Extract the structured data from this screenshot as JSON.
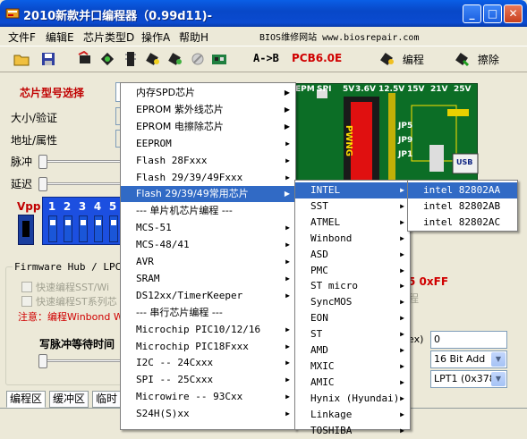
{
  "window": {
    "title": "2010新款并口编程器（0.99d11)-"
  },
  "title_buttons": {
    "minimize": "_",
    "maximize": "□",
    "close": "✕"
  },
  "menubar": {
    "items": [
      "文件F",
      "编辑E",
      "芯片类型D",
      "操作A",
      "帮助H"
    ],
    "site": "BIOS维修网站 www.biosrepair.com"
  },
  "toolbar": {
    "ab_label": "A->B",
    "pcb_label": "PCB6.0E",
    "program_label": "编程",
    "erase_label": "擦除"
  },
  "left_panel": {
    "chip_select_label": "芯片型号选择",
    "size_label": "大小/验证",
    "addr_label": "地址/属性",
    "pulse_label": "脉冲",
    "delay_label": "延迟",
    "vpp_label": "Vpp",
    "vpp_pins": [
      "1",
      "2",
      "3",
      "4",
      "5"
    ],
    "fwh_label": "Firmware Hub / LPC",
    "fast_sst": "快速编程SST/Wi",
    "fast_st": "快速编程ST系列芯",
    "note": "注意：编程Winbond W",
    "write_wait_label": "写脉冲等待时间"
  },
  "board": {
    "labels": [
      "EPM",
      "SPI",
      "5V",
      "3.6V",
      "12.5V",
      "15V",
      "21V",
      "25V",
      "JP5",
      "JP9",
      "JP1",
      "USB",
      "PWNG"
    ]
  },
  "right_panel": {
    "ox_text": "5 0xFF",
    "prog_text": "程",
    "ex_label": "ex)",
    "ex_value": "0",
    "addr_mode": "16 Bit Add",
    "port": "LPT1 (0x378)"
  },
  "menu1": {
    "items": [
      {
        "label": "内存SPD芯片",
        "arrow": true,
        "cn": true
      },
      {
        "label": "EPROM 紫外线芯片",
        "arrow": true,
        "cn": true
      },
      {
        "label": "EPROM 电擦除芯片",
        "arrow": true,
        "cn": true
      },
      {
        "label": "EEPROM",
        "arrow": true
      },
      {
        "label": "Flash 28Fxxx",
        "arrow": true
      },
      {
        "label": "Flash 29/39/49Fxxx",
        "arrow": true
      },
      {
        "label": "Flash 29/39/49常用芯片",
        "arrow": true,
        "selected": true,
        "cn": true
      },
      {
        "label": "--- 单片机芯片编程 ---",
        "separator": true
      },
      {
        "label": "MCS-51",
        "arrow": true
      },
      {
        "label": "MCS-48/41",
        "arrow": true
      },
      {
        "label": "AVR",
        "arrow": true
      },
      {
        "label": "SRAM",
        "arrow": true
      },
      {
        "label": "DS12xx/TimerKeeper",
        "arrow": true
      },
      {
        "label": "--- 串行芯片编程 ---",
        "separator": true
      },
      {
        "label": "Microchip PIC10/12/16",
        "arrow": true
      },
      {
        "label": "Microchip PIC18Fxxx",
        "arrow": true
      },
      {
        "label": "I2C -- 24Cxxx",
        "arrow": true
      },
      {
        "label": "SPI -- 25Cxxx",
        "arrow": true
      },
      {
        "label": "Microwire -- 93Cxx",
        "arrow": true
      },
      {
        "label": "S24H(S)xx",
        "arrow": true
      }
    ]
  },
  "menu2": {
    "items": [
      {
        "label": "INTEL",
        "selected": true
      },
      {
        "label": "SST"
      },
      {
        "label": "ATMEL"
      },
      {
        "label": "Winbond"
      },
      {
        "label": "ASD"
      },
      {
        "label": "PMC"
      },
      {
        "label": "ST micro"
      },
      {
        "label": "SyncMOS"
      },
      {
        "label": "EON"
      },
      {
        "label": "ST"
      },
      {
        "label": "AMD"
      },
      {
        "label": "MXIC"
      },
      {
        "label": "AMIC"
      },
      {
        "label": "Hynix (Hyundai)"
      },
      {
        "label": "Linkage"
      },
      {
        "label": "TOSHIBA"
      }
    ]
  },
  "menu3": {
    "items": [
      {
        "label": "intel 82802AA",
        "selected": true
      },
      {
        "label": "intel 82802AB"
      },
      {
        "label": "intel 82802AC"
      }
    ]
  },
  "tabs": [
    "编程区",
    "缓冲区",
    "临时"
  ]
}
